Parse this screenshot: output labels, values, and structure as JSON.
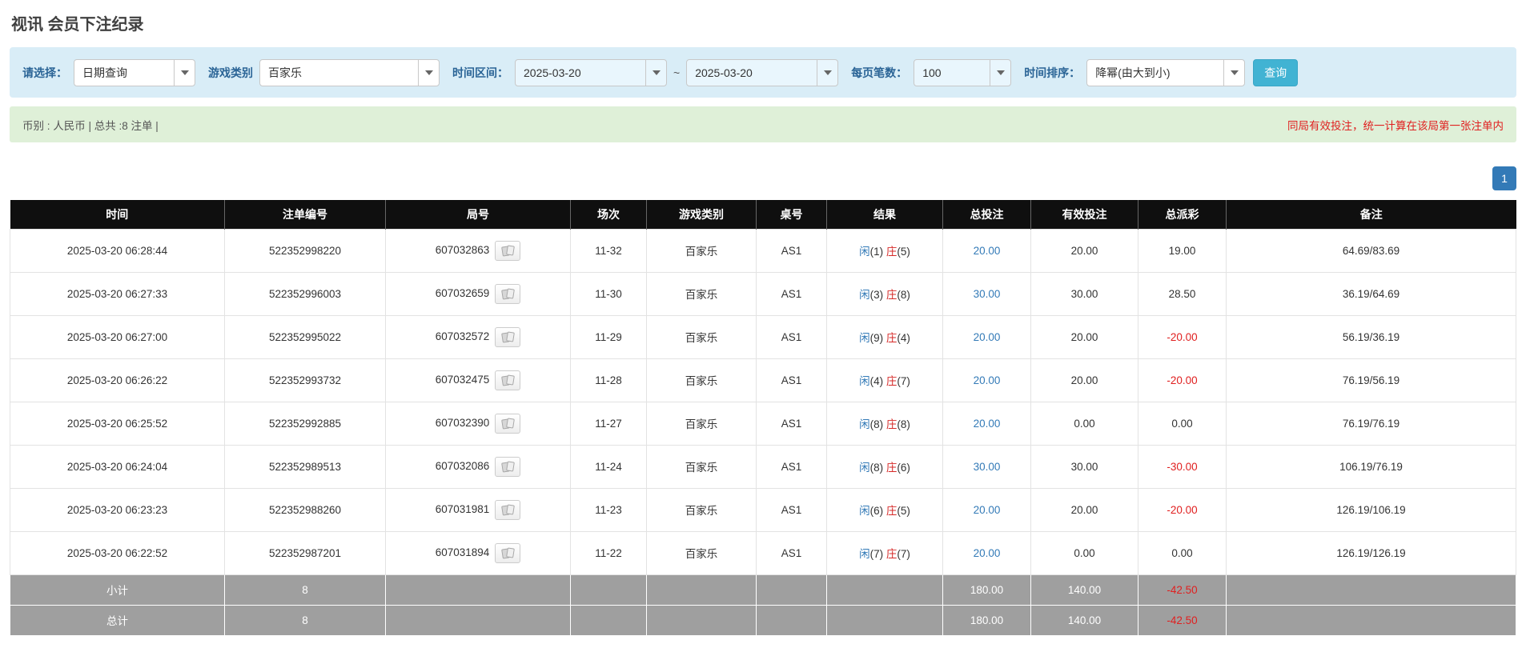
{
  "colors": {
    "accent_blue": "#337ab7",
    "banker_red": "#d62a28",
    "negative_red": "#e02020",
    "filter_bar_bg": "#d9edf7",
    "summary_bar_bg": "#dff0d8",
    "table_header_bg": "#0f0f0f",
    "table_footer_bg": "#9f9f9f",
    "search_button_bg": "#41b3d3"
  },
  "page": {
    "title": "视讯 会员下注纪录"
  },
  "filters": {
    "select_label": "请选择：",
    "select_value": "日期查询",
    "game_type_label": "游戏类别",
    "game_type_value": "百家乐",
    "date_range_label": "时间区间：",
    "date_from": "2025-03-20",
    "date_separator": "~",
    "date_to": "2025-03-20",
    "page_size_label": "每页笔数：",
    "page_size_value": "100",
    "sort_label": "时间排序：",
    "sort_value": "降幂(由大到小)",
    "search_button": "查询"
  },
  "summary_bar": {
    "left": "币别 : 人民币 | 总共 :8 注单 |",
    "right": "同局有效投注，统一计算在该局第一张注单内"
  },
  "pagination": {
    "current": "1"
  },
  "icons": {
    "dropdown": "chevron-down",
    "round_cards": "playing-cards"
  },
  "table": {
    "headers": [
      "时间",
      "注单编号",
      "局号",
      "场次",
      "游戏类别",
      "桌号",
      "结果",
      "总投注",
      "有效投注",
      "总派彩",
      "备注"
    ],
    "rows": [
      {
        "time": "2025-03-20 06:28:44",
        "bet_id": "522352998220",
        "round_id": "607032863",
        "session": "11-32",
        "game": "百家乐",
        "table_no": "AS1",
        "player": "闲",
        "player_n": "(1)",
        "banker": "庄",
        "banker_n": "(5)",
        "total_bet": "20.00",
        "valid_bet": "20.00",
        "payout": "19.00",
        "remark": "64.69/83.69"
      },
      {
        "time": "2025-03-20 06:27:33",
        "bet_id": "522352996003",
        "round_id": "607032659",
        "session": "11-30",
        "game": "百家乐",
        "table_no": "AS1",
        "player": "闲",
        "player_n": "(3)",
        "banker": "庄",
        "banker_n": "(8)",
        "total_bet": "30.00",
        "valid_bet": "30.00",
        "payout": "28.50",
        "remark": "36.19/64.69"
      },
      {
        "time": "2025-03-20 06:27:00",
        "bet_id": "522352995022",
        "round_id": "607032572",
        "session": "11-29",
        "game": "百家乐",
        "table_no": "AS1",
        "player": "闲",
        "player_n": "(9)",
        "banker": "庄",
        "banker_n": "(4)",
        "total_bet": "20.00",
        "valid_bet": "20.00",
        "payout": "-20.00",
        "remark": "56.19/36.19"
      },
      {
        "time": "2025-03-20 06:26:22",
        "bet_id": "522352993732",
        "round_id": "607032475",
        "session": "11-28",
        "game": "百家乐",
        "table_no": "AS1",
        "player": "闲",
        "player_n": "(4)",
        "banker": "庄",
        "banker_n": "(7)",
        "total_bet": "20.00",
        "valid_bet": "20.00",
        "payout": "-20.00",
        "remark": "76.19/56.19"
      },
      {
        "time": "2025-03-20 06:25:52",
        "bet_id": "522352992885",
        "round_id": "607032390",
        "session": "11-27",
        "game": "百家乐",
        "table_no": "AS1",
        "player": "闲",
        "player_n": "(8)",
        "banker": "庄",
        "banker_n": "(8)",
        "total_bet": "20.00",
        "valid_bet": "0.00",
        "payout": "0.00",
        "remark": "76.19/76.19"
      },
      {
        "time": "2025-03-20 06:24:04",
        "bet_id": "522352989513",
        "round_id": "607032086",
        "session": "11-24",
        "game": "百家乐",
        "table_no": "AS1",
        "player": "闲",
        "player_n": "(8)",
        "banker": "庄",
        "banker_n": "(6)",
        "total_bet": "30.00",
        "valid_bet": "30.00",
        "payout": "-30.00",
        "remark": "106.19/76.19"
      },
      {
        "time": "2025-03-20 06:23:23",
        "bet_id": "522352988260",
        "round_id": "607031981",
        "session": "11-23",
        "game": "百家乐",
        "table_no": "AS1",
        "player": "闲",
        "player_n": "(6)",
        "banker": "庄",
        "banker_n": "(5)",
        "total_bet": "20.00",
        "valid_bet": "20.00",
        "payout": "-20.00",
        "remark": "126.19/106.19"
      },
      {
        "time": "2025-03-20 06:22:52",
        "bet_id": "522352987201",
        "round_id": "607031894",
        "session": "11-22",
        "game": "百家乐",
        "table_no": "AS1",
        "player": "闲",
        "player_n": "(7)",
        "banker": "庄",
        "banker_n": "(7)",
        "total_bet": "20.00",
        "valid_bet": "0.00",
        "payout": "0.00",
        "remark": "126.19/126.19"
      }
    ],
    "subtotal": {
      "label": "小计",
      "count": "8",
      "total_bet": "180.00",
      "valid_bet": "140.00",
      "payout": "-42.50"
    },
    "total": {
      "label": "总计",
      "count": "8",
      "total_bet": "180.00",
      "valid_bet": "140.00",
      "payout": "-42.50"
    }
  }
}
